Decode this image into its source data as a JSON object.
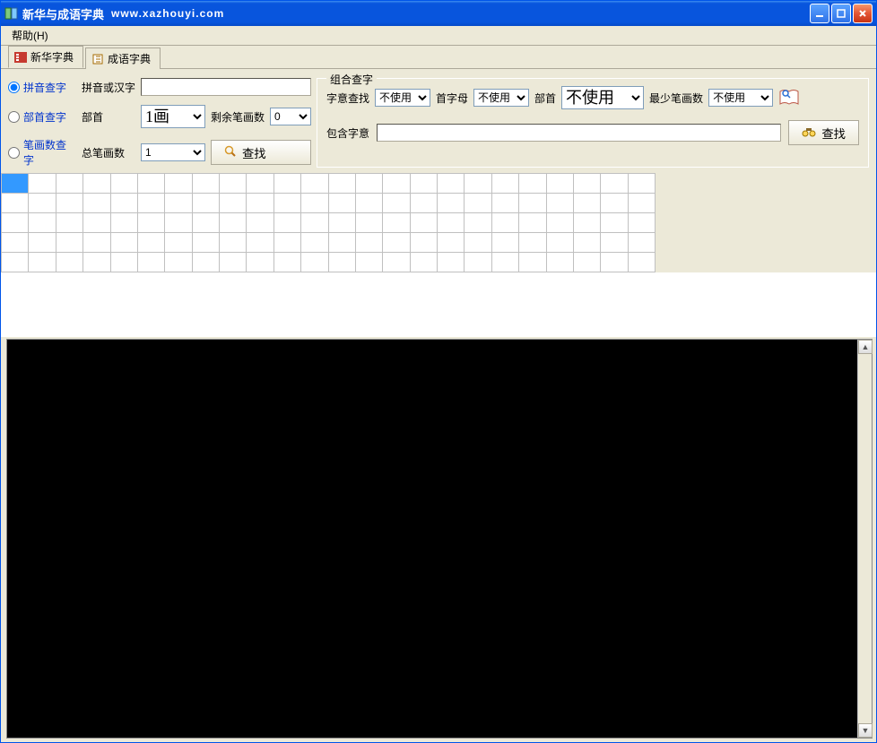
{
  "title": "新华与成语字典",
  "title_url": "www.xazhouyi.com",
  "menu": {
    "help": "帮助(H)"
  },
  "tabs": [
    {
      "label": "新华字典",
      "active": true
    },
    {
      "label": "成语字典",
      "active": false
    }
  ],
  "left_panel": {
    "radios": [
      {
        "label": "拼音查字",
        "checked": true
      },
      {
        "label": "部首查字",
        "checked": false
      },
      {
        "label": "笔画数查字",
        "checked": false
      }
    ],
    "pinyin_label": "拼音或汉字",
    "pinyin_value": "",
    "radical_label": "部首",
    "radical_value": "1画",
    "remain_strokes_label": "剩余笔画数",
    "remain_strokes_value": "0",
    "total_strokes_label": "总笔画数",
    "total_strokes_value": "1",
    "search_button": "查找"
  },
  "combo_panel": {
    "legend": "组合查字",
    "meaning_label": "字意查找",
    "meaning_value": "不使用",
    "initial_label": "首字母",
    "initial_value": "不使用",
    "radical_label": "部首",
    "radical_value": "不使用",
    "min_strokes_label": "最少笔画数",
    "min_strokes_value": "不使用",
    "contain_meaning_label": "包含字意",
    "contain_meaning_value": "",
    "search_button": "查找"
  },
  "grid": {
    "rows": 5,
    "cols": 24,
    "selected": [
      0,
      0
    ]
  }
}
